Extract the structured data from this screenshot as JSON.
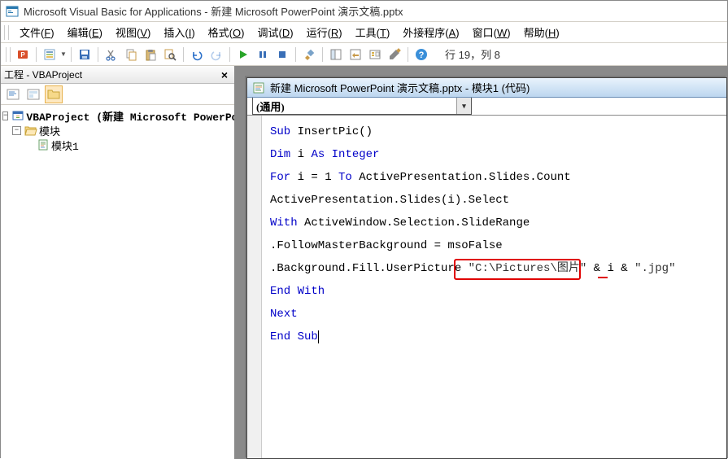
{
  "title": "Microsoft Visual Basic for Applications - 新建 Microsoft PowerPoint 演示文稿.pptx",
  "menu": {
    "file": "文件(F)",
    "edit": "编辑(E)",
    "view": "视图(V)",
    "insert": "插入(I)",
    "format": "格式(O)",
    "debug": "调试(D)",
    "run": "运行(R)",
    "tools": "工具(T)",
    "addins": "外接程序(A)",
    "window": "窗口(W)",
    "help": "帮助(H)"
  },
  "status": "行 19，列 8",
  "project_pane": {
    "title": "工程 - VBAProject",
    "root": "VBAProject (新建 Microsoft PowerPoint 演示文稿.pptx)",
    "folder": "模块",
    "module": "模块1"
  },
  "code_window": {
    "title": "新建 Microsoft PowerPoint 演示文稿.pptx - 模块1 (代码)",
    "dropdown": "(通用)"
  },
  "code": {
    "l1a": "Sub",
    "l1b": " InsertPic()",
    "l2a": "Dim",
    "l2b": " i ",
    "l2c": "As Integer",
    "l3a": "For",
    "l3b": " i = 1 ",
    "l3c": "To",
    "l3d": " ActivePresentation.Slides.Count",
    "l4": "ActivePresentation.Slides(i).Select",
    "l5a": "With",
    "l5b": " ActiveWindow.Selection.SlideRange",
    "l6": ".FollowMasterBackground = msoFalse",
    "l7a": ".Background.Fill.UserPicture ",
    "l7b": "\"C:\\Pictures\\图片\"",
    "l7c": " & i & ",
    "l7d": "\".jpg\"",
    "l8": "End With",
    "l9": "Next",
    "l10": "End Sub"
  }
}
